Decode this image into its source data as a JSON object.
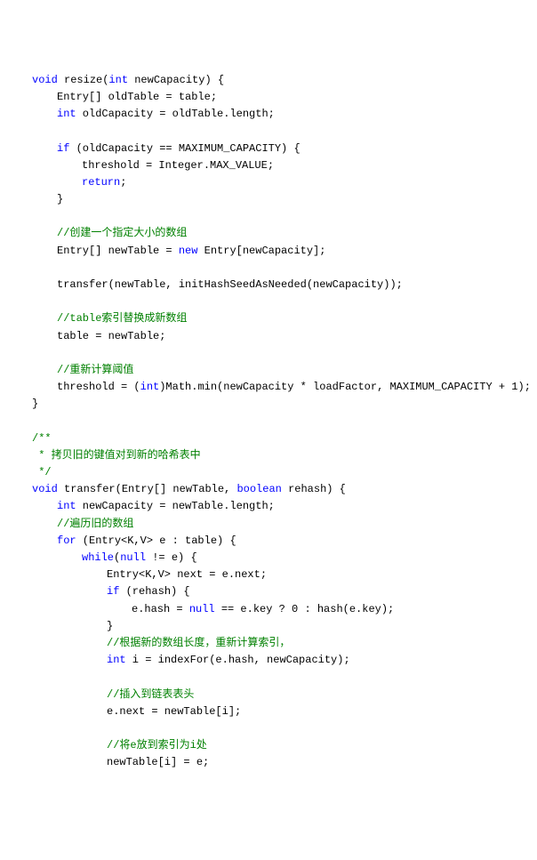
{
  "code": {
    "lines": [
      {
        "indent": 1,
        "segments": [
          {
            "t": "void",
            "c": "kw"
          },
          {
            "t": " resize(",
            "c": "nm"
          },
          {
            "t": "int",
            "c": "kw"
          },
          {
            "t": " newCapacity) {",
            "c": "nm"
          }
        ]
      },
      {
        "indent": 2,
        "segments": [
          {
            "t": "Entry[] oldTable = table;",
            "c": "nm"
          }
        ]
      },
      {
        "indent": 2,
        "segments": [
          {
            "t": "int",
            "c": "kw"
          },
          {
            "t": " oldCapacity = oldTable.length;",
            "c": "nm"
          }
        ]
      },
      {
        "indent": 0,
        "segments": []
      },
      {
        "indent": 2,
        "segments": [
          {
            "t": "if",
            "c": "kw"
          },
          {
            "t": " (oldCapacity == MAXIMUM_CAPACITY) {",
            "c": "nm"
          }
        ]
      },
      {
        "indent": 3,
        "segments": [
          {
            "t": "threshold = Integer.MAX_VALUE;",
            "c": "nm"
          }
        ]
      },
      {
        "indent": 3,
        "segments": [
          {
            "t": "return",
            "c": "kw"
          },
          {
            "t": ";",
            "c": "nm"
          }
        ]
      },
      {
        "indent": 2,
        "segments": [
          {
            "t": "}",
            "c": "nm"
          }
        ]
      },
      {
        "indent": 0,
        "segments": []
      },
      {
        "indent": 2,
        "segments": [
          {
            "t": "//创建一个指定大小的数组",
            "c": "cm"
          }
        ]
      },
      {
        "indent": 2,
        "segments": [
          {
            "t": "Entry[] newTable = ",
            "c": "nm"
          },
          {
            "t": "new",
            "c": "kw"
          },
          {
            "t": " Entry[newCapacity];",
            "c": "nm"
          }
        ]
      },
      {
        "indent": 0,
        "segments": []
      },
      {
        "indent": 2,
        "segments": [
          {
            "t": "transfer(newTable, initHashSeedAsNeeded(newCapacity));",
            "c": "nm"
          }
        ]
      },
      {
        "indent": 0,
        "segments": []
      },
      {
        "indent": 2,
        "segments": [
          {
            "t": "//table索引替换成新数组",
            "c": "cm"
          }
        ]
      },
      {
        "indent": 2,
        "segments": [
          {
            "t": "table = newTable;",
            "c": "nm"
          }
        ]
      },
      {
        "indent": 0,
        "segments": []
      },
      {
        "indent": 2,
        "segments": [
          {
            "t": "//重新计算阈值",
            "c": "cm"
          }
        ]
      },
      {
        "indent": 2,
        "segments": [
          {
            "t": "threshold = (",
            "c": "nm"
          },
          {
            "t": "int",
            "c": "kw"
          },
          {
            "t": ")Math.min(newCapacity * loadFactor, MAXIMUM_CAPACITY + 1);",
            "c": "nm"
          }
        ]
      },
      {
        "indent": 1,
        "segments": [
          {
            "t": "}",
            "c": "nm"
          }
        ]
      },
      {
        "indent": 0,
        "segments": []
      },
      {
        "indent": 1,
        "segments": [
          {
            "t": "/**",
            "c": "doc"
          }
        ]
      },
      {
        "indent": 1,
        "segments": [
          {
            "t": " * 拷贝旧的键值对到新的哈希表中",
            "c": "doc"
          }
        ]
      },
      {
        "indent": 1,
        "segments": [
          {
            "t": " */",
            "c": "doc"
          }
        ]
      },
      {
        "indent": 1,
        "segments": [
          {
            "t": "void",
            "c": "kw"
          },
          {
            "t": " transfer(Entry[] newTable, ",
            "c": "nm"
          },
          {
            "t": "boolean",
            "c": "kw"
          },
          {
            "t": " rehash) {",
            "c": "nm"
          }
        ]
      },
      {
        "indent": 2,
        "segments": [
          {
            "t": "int",
            "c": "kw"
          },
          {
            "t": " newCapacity = newTable.length;",
            "c": "nm"
          }
        ]
      },
      {
        "indent": 2,
        "segments": [
          {
            "t": "//遍历旧的数组",
            "c": "cm"
          }
        ]
      },
      {
        "indent": 2,
        "segments": [
          {
            "t": "for",
            "c": "kw"
          },
          {
            "t": " (Entry<K,V> e : table) {",
            "c": "nm"
          }
        ]
      },
      {
        "indent": 3,
        "segments": [
          {
            "t": "while",
            "c": "kw"
          },
          {
            "t": "(",
            "c": "nm"
          },
          {
            "t": "null",
            "c": "kw"
          },
          {
            "t": " != e) {",
            "c": "nm"
          }
        ]
      },
      {
        "indent": 4,
        "segments": [
          {
            "t": "Entry<K,V> next = e.next;",
            "c": "nm"
          }
        ]
      },
      {
        "indent": 4,
        "segments": [
          {
            "t": "if",
            "c": "kw"
          },
          {
            "t": " (rehash) {",
            "c": "nm"
          }
        ]
      },
      {
        "indent": 5,
        "segments": [
          {
            "t": "e.hash = ",
            "c": "nm"
          },
          {
            "t": "null",
            "c": "kw"
          },
          {
            "t": " == e.key ? 0 : hash(e.key);",
            "c": "nm"
          }
        ]
      },
      {
        "indent": 4,
        "segments": [
          {
            "t": "}",
            "c": "nm"
          }
        ]
      },
      {
        "indent": 4,
        "segments": [
          {
            "t": "//根据新的数组长度，重新计算索引，",
            "c": "cm"
          }
        ]
      },
      {
        "indent": 4,
        "segments": [
          {
            "t": "int",
            "c": "kw"
          },
          {
            "t": " i = indexFor(e.hash, newCapacity);",
            "c": "nm"
          }
        ]
      },
      {
        "indent": 0,
        "segments": []
      },
      {
        "indent": 4,
        "segments": [
          {
            "t": "//插入到链表表头",
            "c": "cm"
          }
        ]
      },
      {
        "indent": 4,
        "segments": [
          {
            "t": "e.next = newTable[i];",
            "c": "nm"
          }
        ]
      },
      {
        "indent": 0,
        "segments": []
      },
      {
        "indent": 4,
        "segments": [
          {
            "t": "//将e放到索引为i处",
            "c": "cm"
          }
        ]
      },
      {
        "indent": 4,
        "segments": [
          {
            "t": "newTable[i] = e;",
            "c": "nm"
          }
        ]
      }
    ]
  }
}
